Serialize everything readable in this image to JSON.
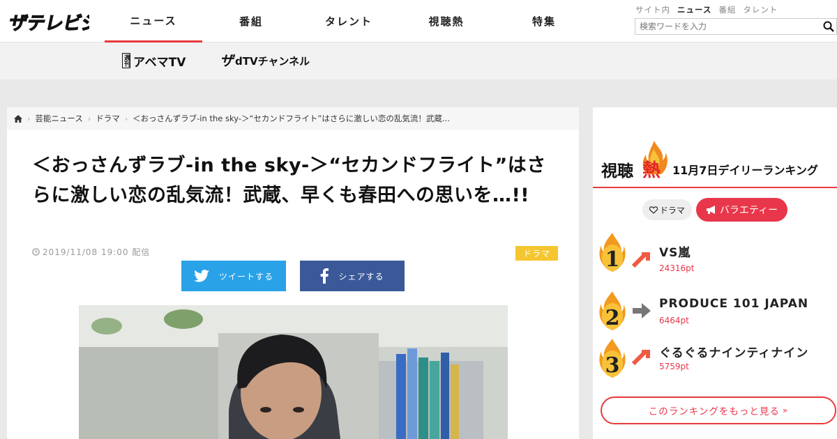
{
  "header": {
    "logo_text": "ザテレビジョン",
    "nav": [
      {
        "label": "ニュース",
        "active": true
      },
      {
        "label": "番組",
        "active": false
      },
      {
        "label": "タレント",
        "active": false
      },
      {
        "label": "視聴熱",
        "active": false
      },
      {
        "label": "特集",
        "active": false
      }
    ],
    "search": {
      "scopes": [
        {
          "label": "サイト内",
          "active": false
        },
        {
          "label": "ニュース",
          "active": true
        },
        {
          "label": "番組",
          "active": false
        },
        {
          "label": "タレント",
          "active": false
        }
      ],
      "placeholder": "検索ワードを入力"
    }
  },
  "subbar": {
    "abema_tag": "週刊",
    "abema_label": "アベマTV",
    "dtv_label": "dTVチャンネル"
  },
  "article": {
    "breadcrumb": [
      "芸能ニュース",
      "ドラマ",
      "＜おっさんずラブ-in the sky-＞“セカンドフライト”はさらに激しい恋の乱気流！武蔵..."
    ],
    "title": "＜おっさんずラブ-in the sky-＞“セカンドフライト”はさらに激しい恋の乱気流！武蔵、早くも春田への思いを…!!",
    "date": "2019/11/08 19:00 配信",
    "category": "ドラマ",
    "tweet_label": "ツイートする",
    "share_label": "シェアする"
  },
  "ranking": {
    "title_prefix": "視聴",
    "title_fire": "熱",
    "subtitle": "11月7日デイリーランキング",
    "tab_drama": "ドラマ",
    "tab_variety": "バラエティー",
    "items": [
      {
        "rank": "1",
        "title": "VS嵐",
        "points": "24316pt",
        "trend": "up"
      },
      {
        "rank": "2",
        "title": "PRODUCE 101 JAPAN",
        "points": "6464pt",
        "trend": "flat"
      },
      {
        "rank": "3",
        "title": "ぐるぐるナインティナイン",
        "points": "5759pt",
        "trend": "up"
      }
    ],
    "more_label": "このランキングをもっと見る"
  },
  "colors": {
    "accent": "#e83a3a",
    "twitter": "#2aa2e8",
    "facebook": "#3b5999",
    "badge": "#f5c630"
  }
}
